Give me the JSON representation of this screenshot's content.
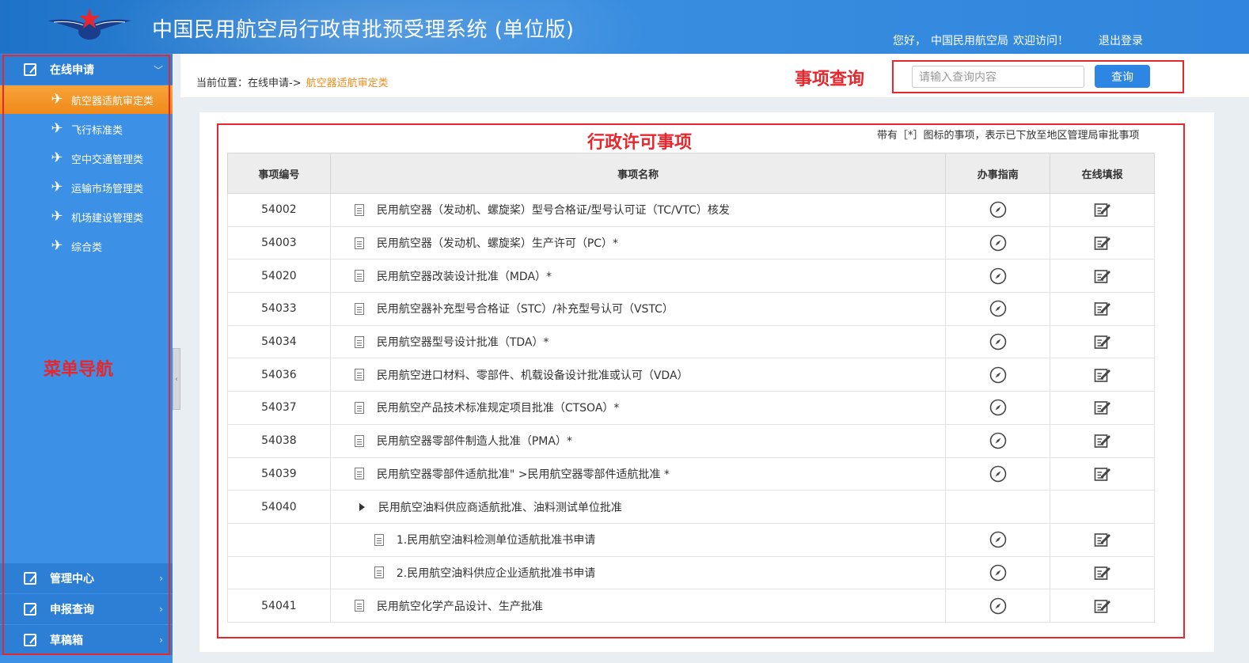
{
  "header": {
    "title": "中国民用航空局行政审批预受理系统 (单位版)",
    "greeting": "您好，",
    "user": "中国民用航空局",
    "welcome": "欢迎访问！",
    "logout": "退出登录"
  },
  "sidebar": {
    "online_apply": "在线申请",
    "items": [
      {
        "label": "航空器适航审定类",
        "active": true
      },
      {
        "label": "飞行标准类",
        "active": false
      },
      {
        "label": "空中交通管理类",
        "active": false
      },
      {
        "label": "运输市场管理类",
        "active": false
      },
      {
        "label": "机场建设管理类",
        "active": false
      },
      {
        "label": "综合类",
        "active": false
      }
    ],
    "nav_annotation": "菜单导航",
    "bottom": {
      "management": "管理中心",
      "report_query": "申报查询",
      "drafts": "草稿箱"
    }
  },
  "topbar": {
    "location_label": "当前位置：在线申请->",
    "current": "航空器适航审定类",
    "query_annotation": "事项查询",
    "search_placeholder": "请输入查询内容",
    "search_button": "查询"
  },
  "main": {
    "title_annotation": "行政许可事项",
    "note": "带有［*］图标的事项，表示已下放至地区管理局审批事项",
    "columns": [
      "事项编号",
      "事项名称",
      "办事指南",
      "在线填报"
    ],
    "rows": [
      {
        "code": "54002",
        "name": "民用航空器（发动机、螺旋桨）型号合格证/型号认可证（TC/VTC）核发"
      },
      {
        "code": "54003",
        "name": "民用航空器（发动机、螺旋桨）生产许可（PC）*"
      },
      {
        "code": "54020",
        "name": "民用航空器改装设计批准（MDA）*"
      },
      {
        "code": "54033",
        "name": "民用航空器补充型号合格证（STC）/补充型号认可（VSTC）"
      },
      {
        "code": "54034",
        "name": "民用航空器型号设计批准（TDA）*"
      },
      {
        "code": "54036",
        "name": "民用航空进口材料、零部件、机载设备设计批准或认可（VDA）"
      },
      {
        "code": "54037",
        "name": "民用航空产品技术标准规定项目批准（CTSOA）*"
      },
      {
        "code": "54038",
        "name": "民用航空器零部件制造人批准（PMA）*"
      },
      {
        "code": "54039",
        "name": "民用航空器零部件适航批准\" >民用航空器零部件适航批准 *"
      },
      {
        "code": "54040",
        "name": "民用航空油料供应商适航批准、油料测试单位批准"
      },
      {
        "code": "",
        "name": "1.民用航空油料检测单位适航批准书申请"
      },
      {
        "code": "",
        "name": "2.民用航空油料供应企业适航批准书申请"
      },
      {
        "code": "54041",
        "name": "民用航空化学产品设计、生产批准"
      }
    ]
  },
  "colors": {
    "header_bg": "#2f86dc",
    "sidebar_bg": "#3c91e6",
    "active_item": "#f08a1a",
    "annotation_red": "#e8262c",
    "button_blue": "#2d86e3"
  }
}
